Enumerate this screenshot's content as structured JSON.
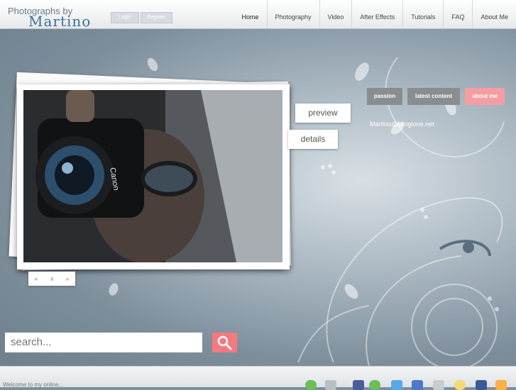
{
  "header": {
    "logo_top": "Photographs by",
    "logo_main": "Martino",
    "login_label": "Login",
    "register_label": "Register",
    "nav": [
      "Home",
      "Photography",
      "Video",
      "After Effects",
      "Tutorials",
      "FAQ",
      "About Me"
    ],
    "active_nav": "Home"
  },
  "slideshow": {
    "preview_label": "preview",
    "details_label": "details",
    "controls": {
      "prev": "«",
      "pause": "॥",
      "next": "»"
    }
  },
  "tabs": [
    {
      "label": "passion",
      "color": "#8a8d90"
    },
    {
      "label": "latest content",
      "color": "#8a8d90"
    },
    {
      "label": "about me",
      "color": "#f49ea2"
    }
  ],
  "email": "Martino@Mingione.net",
  "search": {
    "placeholder": "search..."
  },
  "footer": {
    "text": "Welcome to my online..."
  },
  "colors": {
    "accent": "#f47a7f",
    "logo": "#3e6f94"
  }
}
